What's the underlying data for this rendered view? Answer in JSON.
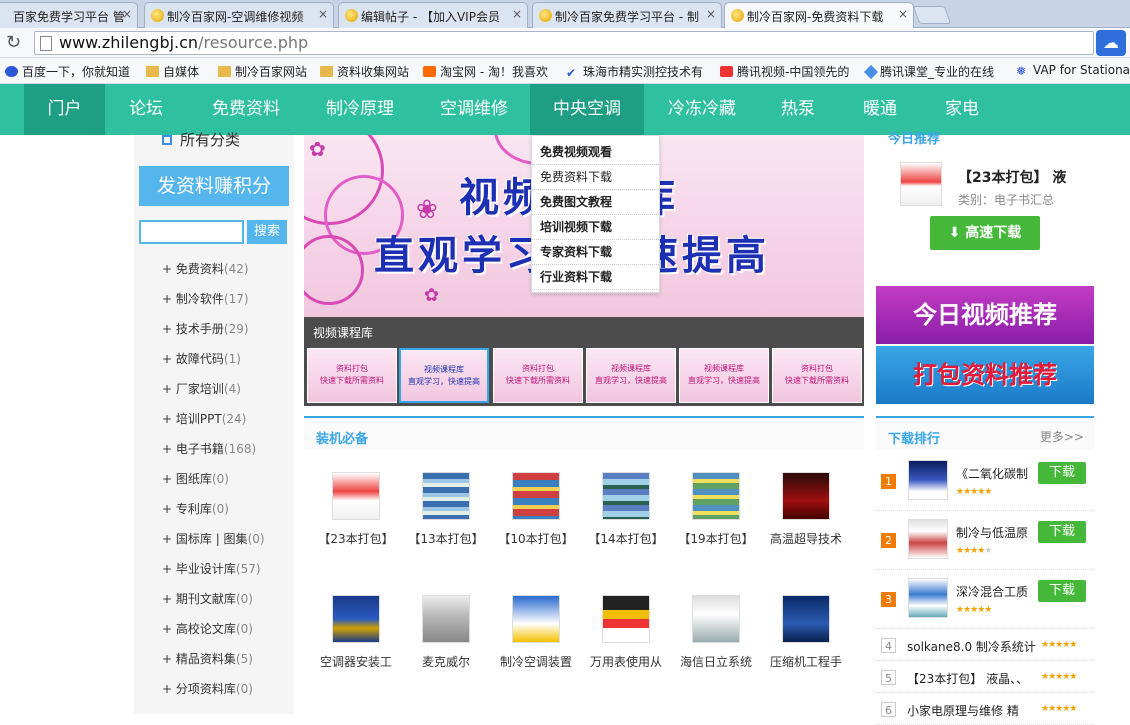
{
  "browser": {
    "tabs": [
      {
        "title": "百家免费学习平台 管"
      },
      {
        "title": "制冷百家网-空调维修视频"
      },
      {
        "title": "编辑帖子 - 【加入VIP会员"
      },
      {
        "title": "制冷百家免费学习平台 - 制"
      },
      {
        "title": "制冷百家网-免费资料下载"
      }
    ],
    "close_glyph": "×",
    "url_host": "www.zhilengbj.cn",
    "url_path": "/resource.php",
    "bookmarks": [
      {
        "label": "百度一下，你就知道",
        "icon": "paw-icon"
      },
      {
        "label": "自媒体",
        "icon": "folder-icon"
      },
      {
        "label": "制冷百家网站",
        "icon": "folder-icon"
      },
      {
        "label": "资料收集网站",
        "icon": "folder-icon"
      },
      {
        "label": "淘宝网 - 淘！我喜欢",
        "icon": "taobao-icon"
      },
      {
        "label": "珠海市精实测控技术有",
        "icon": "site-icon"
      },
      {
        "label": "腾讯视频-中国领先的",
        "icon": "site-icon"
      },
      {
        "label": "腾讯课堂_专业的在线",
        "icon": "site-icon"
      },
      {
        "label": "VAP for Stationa",
        "icon": "site-icon"
      }
    ]
  },
  "nav": {
    "items": [
      "门户",
      "论坛",
      "免费资料",
      "制冷原理",
      "空调维修",
      "中央空调",
      "冷冻冷藏",
      "热泵",
      "暖通",
      "家电"
    ]
  },
  "dropdown": {
    "items": [
      "免费视频观看",
      "免费资料下载",
      "免费图文教程",
      "培训视频下载",
      "专家资料下载",
      "行业资料下载"
    ]
  },
  "sidebar": {
    "all_categories": "所有分类",
    "post_button": "发资料赚积分",
    "search_button": "搜索",
    "search_value": "",
    "categories": [
      {
        "name": "免费资料",
        "count": "(42)"
      },
      {
        "name": "制冷软件",
        "count": "(17)"
      },
      {
        "name": "技术手册",
        "count": "(29)"
      },
      {
        "name": "故障代码",
        "count": "(1)"
      },
      {
        "name": "厂家培训",
        "count": "(4)"
      },
      {
        "name": "培训PPT",
        "count": "(24)"
      },
      {
        "name": "电子书籍",
        "count": "(168)"
      },
      {
        "name": "图纸库",
        "count": "(0)"
      },
      {
        "name": "专利库",
        "count": "(0)"
      },
      {
        "name": "国标库 | 图集",
        "count": "(0)"
      },
      {
        "name": "毕业设计库",
        "count": "(57)"
      },
      {
        "name": "期刊文献库",
        "count": "(0)"
      },
      {
        "name": "高校论文库",
        "count": "(0)"
      },
      {
        "name": "精品资料集",
        "count": "(5)"
      },
      {
        "name": "分项资料库",
        "count": "(0)"
      }
    ]
  },
  "banner": {
    "line1": "视频课程库",
    "line2": "直观学习，快速提高"
  },
  "video_bar": {
    "title": "视频课程库",
    "thumbs": [
      {
        "l1": "资料打包",
        "l2": "快速下载所需资料"
      },
      {
        "l1": "视频课程库",
        "l2": "直观学习，快速提高"
      },
      {
        "l1": "资料打包",
        "l2": "快速下载所需资料"
      },
      {
        "l1": "视频课程库",
        "l2": "直观学习，快速提高"
      },
      {
        "l1": "视频课程库",
        "l2": "直观学习，快速提高"
      },
      {
        "l1": "资料打包",
        "l2": "快速下载所需资料"
      }
    ]
  },
  "essentials": {
    "title": "装机必备",
    "items": [
      "【23本打包】",
      "【13本打包】",
      "【10本打包】",
      "【14本打包】",
      "【19本打包】",
      "高温超导技术",
      "空调器安装工",
      "麦克威尔",
      "制冷空调装置",
      "万用表使用从",
      "海信日立系统",
      "压缩机工程手"
    ]
  },
  "today": {
    "title": "今日推荐",
    "name": "【23本打包】 液",
    "category": "类别：电子书汇总",
    "download": "高速下载"
  },
  "promos": {
    "video": "今日视频推荐",
    "pack": "打包资料推荐"
  },
  "ranking": {
    "title": "下载排行",
    "more": "更多>>",
    "download_label": "下载",
    "items": [
      {
        "rank": "1",
        "name": "《二氧化碳制",
        "stars": 5
      },
      {
        "rank": "2",
        "name": "制冷与低温原",
        "stars": 4
      },
      {
        "rank": "3",
        "name": "深冷混合工质",
        "stars": 5
      },
      {
        "rank": "4",
        "name": "solkane8.0 制冷系统计",
        "stars": 5
      },
      {
        "rank": "5",
        "name": "【23本打包】 液晶、、",
        "stars": 5
      },
      {
        "rank": "6",
        "name": "小家电原理与维修 精",
        "stars": 5
      }
    ]
  },
  "colors": {
    "nav_bg": "#2fc0a0",
    "nav_active": "#1e9f83",
    "accent_blue": "#3aa6e6",
    "download_green": "#45b839"
  }
}
